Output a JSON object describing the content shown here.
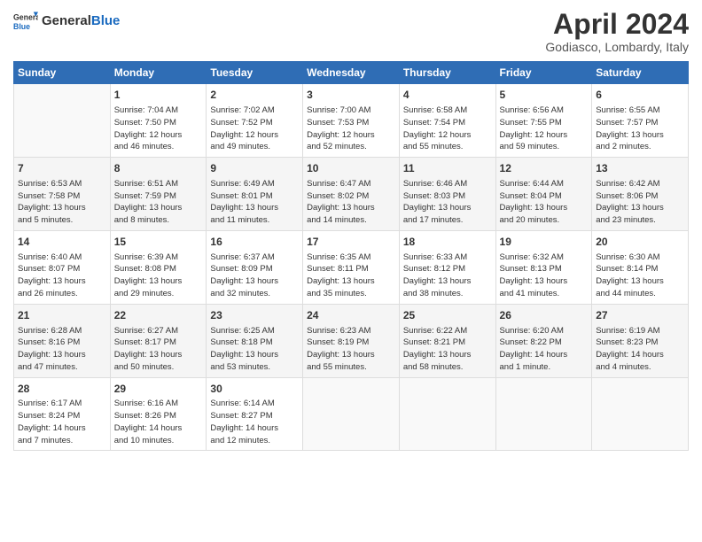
{
  "header": {
    "logo_general": "General",
    "logo_blue": "Blue",
    "month_title": "April 2024",
    "subtitle": "Godiasco, Lombardy, Italy"
  },
  "days_of_week": [
    "Sunday",
    "Monday",
    "Tuesday",
    "Wednesday",
    "Thursday",
    "Friday",
    "Saturday"
  ],
  "weeks": [
    [
      {
        "day": "",
        "info": ""
      },
      {
        "day": "1",
        "info": "Sunrise: 7:04 AM\nSunset: 7:50 PM\nDaylight: 12 hours\nand 46 minutes."
      },
      {
        "day": "2",
        "info": "Sunrise: 7:02 AM\nSunset: 7:52 PM\nDaylight: 12 hours\nand 49 minutes."
      },
      {
        "day": "3",
        "info": "Sunrise: 7:00 AM\nSunset: 7:53 PM\nDaylight: 12 hours\nand 52 minutes."
      },
      {
        "day": "4",
        "info": "Sunrise: 6:58 AM\nSunset: 7:54 PM\nDaylight: 12 hours\nand 55 minutes."
      },
      {
        "day": "5",
        "info": "Sunrise: 6:56 AM\nSunset: 7:55 PM\nDaylight: 12 hours\nand 59 minutes."
      },
      {
        "day": "6",
        "info": "Sunrise: 6:55 AM\nSunset: 7:57 PM\nDaylight: 13 hours\nand 2 minutes."
      }
    ],
    [
      {
        "day": "7",
        "info": "Sunrise: 6:53 AM\nSunset: 7:58 PM\nDaylight: 13 hours\nand 5 minutes."
      },
      {
        "day": "8",
        "info": "Sunrise: 6:51 AM\nSunset: 7:59 PM\nDaylight: 13 hours\nand 8 minutes."
      },
      {
        "day": "9",
        "info": "Sunrise: 6:49 AM\nSunset: 8:01 PM\nDaylight: 13 hours\nand 11 minutes."
      },
      {
        "day": "10",
        "info": "Sunrise: 6:47 AM\nSunset: 8:02 PM\nDaylight: 13 hours\nand 14 minutes."
      },
      {
        "day": "11",
        "info": "Sunrise: 6:46 AM\nSunset: 8:03 PM\nDaylight: 13 hours\nand 17 minutes."
      },
      {
        "day": "12",
        "info": "Sunrise: 6:44 AM\nSunset: 8:04 PM\nDaylight: 13 hours\nand 20 minutes."
      },
      {
        "day": "13",
        "info": "Sunrise: 6:42 AM\nSunset: 8:06 PM\nDaylight: 13 hours\nand 23 minutes."
      }
    ],
    [
      {
        "day": "14",
        "info": "Sunrise: 6:40 AM\nSunset: 8:07 PM\nDaylight: 13 hours\nand 26 minutes."
      },
      {
        "day": "15",
        "info": "Sunrise: 6:39 AM\nSunset: 8:08 PM\nDaylight: 13 hours\nand 29 minutes."
      },
      {
        "day": "16",
        "info": "Sunrise: 6:37 AM\nSunset: 8:09 PM\nDaylight: 13 hours\nand 32 minutes."
      },
      {
        "day": "17",
        "info": "Sunrise: 6:35 AM\nSunset: 8:11 PM\nDaylight: 13 hours\nand 35 minutes."
      },
      {
        "day": "18",
        "info": "Sunrise: 6:33 AM\nSunset: 8:12 PM\nDaylight: 13 hours\nand 38 minutes."
      },
      {
        "day": "19",
        "info": "Sunrise: 6:32 AM\nSunset: 8:13 PM\nDaylight: 13 hours\nand 41 minutes."
      },
      {
        "day": "20",
        "info": "Sunrise: 6:30 AM\nSunset: 8:14 PM\nDaylight: 13 hours\nand 44 minutes."
      }
    ],
    [
      {
        "day": "21",
        "info": "Sunrise: 6:28 AM\nSunset: 8:16 PM\nDaylight: 13 hours\nand 47 minutes."
      },
      {
        "day": "22",
        "info": "Sunrise: 6:27 AM\nSunset: 8:17 PM\nDaylight: 13 hours\nand 50 minutes."
      },
      {
        "day": "23",
        "info": "Sunrise: 6:25 AM\nSunset: 8:18 PM\nDaylight: 13 hours\nand 53 minutes."
      },
      {
        "day": "24",
        "info": "Sunrise: 6:23 AM\nSunset: 8:19 PM\nDaylight: 13 hours\nand 55 minutes."
      },
      {
        "day": "25",
        "info": "Sunrise: 6:22 AM\nSunset: 8:21 PM\nDaylight: 13 hours\nand 58 minutes."
      },
      {
        "day": "26",
        "info": "Sunrise: 6:20 AM\nSunset: 8:22 PM\nDaylight: 14 hours\nand 1 minute."
      },
      {
        "day": "27",
        "info": "Sunrise: 6:19 AM\nSunset: 8:23 PM\nDaylight: 14 hours\nand 4 minutes."
      }
    ],
    [
      {
        "day": "28",
        "info": "Sunrise: 6:17 AM\nSunset: 8:24 PM\nDaylight: 14 hours\nand 7 minutes."
      },
      {
        "day": "29",
        "info": "Sunrise: 6:16 AM\nSunset: 8:26 PM\nDaylight: 14 hours\nand 10 minutes."
      },
      {
        "day": "30",
        "info": "Sunrise: 6:14 AM\nSunset: 8:27 PM\nDaylight: 14 hours\nand 12 minutes."
      },
      {
        "day": "",
        "info": ""
      },
      {
        "day": "",
        "info": ""
      },
      {
        "day": "",
        "info": ""
      },
      {
        "day": "",
        "info": ""
      }
    ]
  ]
}
